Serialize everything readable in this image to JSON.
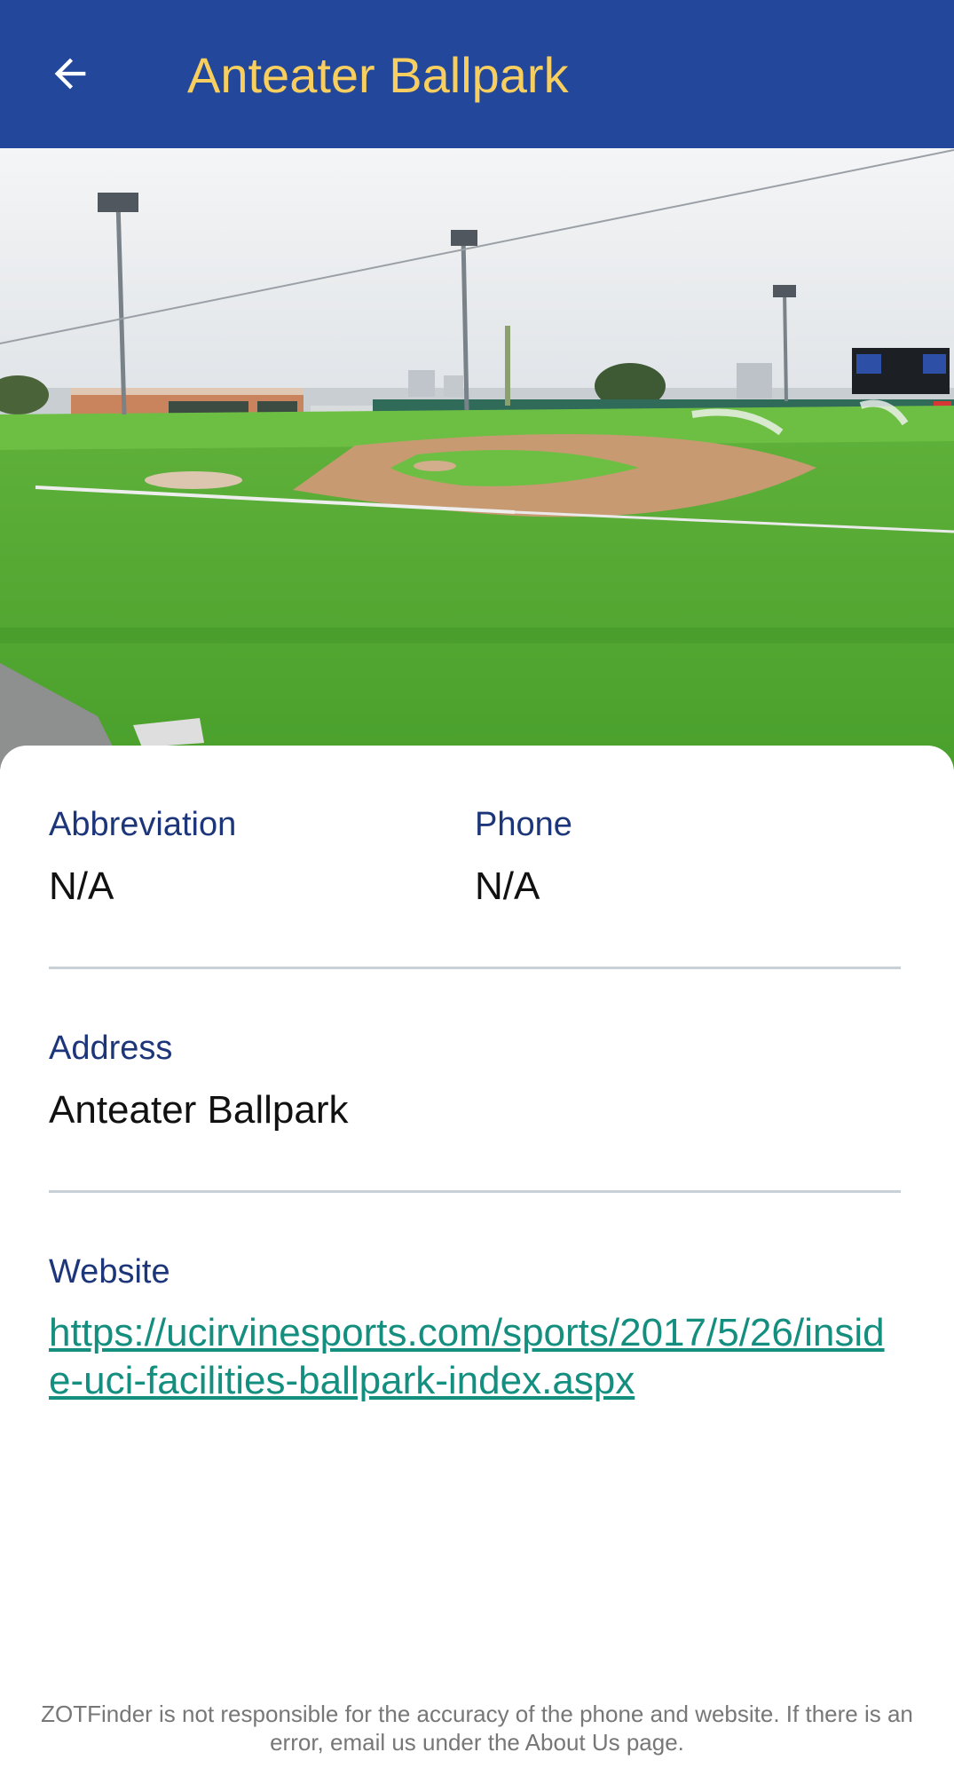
{
  "header": {
    "title": "Anteater Ballpark",
    "back_icon": "arrow-left-icon"
  },
  "hero": {
    "image_subject": "baseball stadium field"
  },
  "details": {
    "abbreviation_label": "Abbreviation",
    "abbreviation_value": "N/A",
    "phone_label": "Phone",
    "phone_value": "N/A",
    "address_label": "Address",
    "address_value": "Anteater Ballpark",
    "website_label": "Website",
    "website_value": "https://ucirvinesports.com/sports/2017/5/26/inside-uci-facilities-ballpark-index.aspx"
  },
  "footer": {
    "disclaimer": "ZOTFinder is not responsible for the accuracy of the phone and website. If there is an error, email us under the About Us page."
  },
  "colors": {
    "appbar": "#23479b",
    "title": "#f8cf5f",
    "label": "#1c3679",
    "link": "#148f7f"
  }
}
